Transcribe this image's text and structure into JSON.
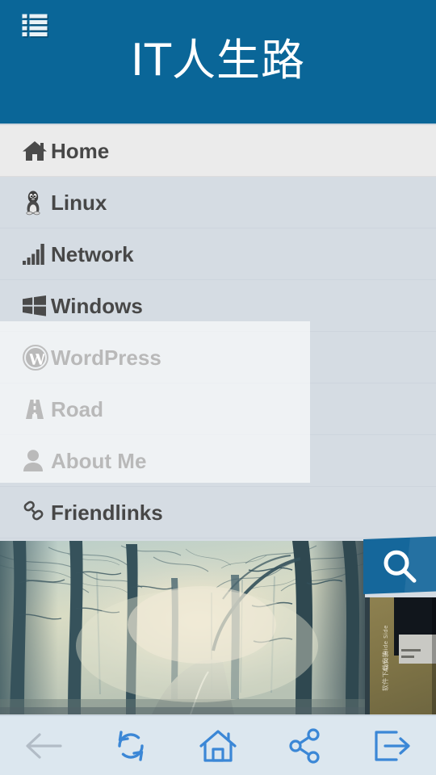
{
  "header": {
    "menu_icon": "list-icon",
    "title": "IT人生路",
    "background_color": "#0a6698",
    "title_color": "#ffffff"
  },
  "nav": {
    "active_index": 0,
    "active_background": "#ebebeb",
    "row_background": "#d5dce3",
    "label_color": "#474747",
    "items": [
      {
        "label": "Home",
        "icon": "home-icon",
        "active": true
      },
      {
        "label": "Linux",
        "icon": "linux-tux-icon",
        "active": false
      },
      {
        "label": "Network",
        "icon": "signal-bars-icon",
        "active": false
      },
      {
        "label": "Windows",
        "icon": "windows-icon",
        "active": false
      },
      {
        "label": "WordPress",
        "icon": "wordpress-icon",
        "active": false
      },
      {
        "label": "Road",
        "icon": "road-icon",
        "active": false
      },
      {
        "label": "About Me",
        "icon": "user-icon",
        "active": false
      },
      {
        "label": "Friendlinks",
        "icon": "chain-link-icon",
        "active": false
      }
    ]
  },
  "hero": {
    "name": "foggy-forest-road-photo",
    "description": "Misty winter forest with bare trees and a road receding into fog"
  },
  "search": {
    "icon": "search-icon",
    "background_color": "#15679b",
    "icon_color": "#ffffff"
  },
  "thumbnail": {
    "name": "article-thumbnail",
    "caption_vertical": "Auto-Hide Side",
    "caption_vertical_2": "软件下载安装"
  },
  "bottombar": {
    "background_color": "#dce7ef",
    "active_color": "#3b87d6",
    "disabled_color": "#b2bcc6",
    "buttons": [
      {
        "name": "back-button",
        "icon": "arrow-left-icon",
        "enabled": false
      },
      {
        "name": "refresh-button",
        "icon": "refresh-icon",
        "enabled": true
      },
      {
        "name": "home-button",
        "icon": "home-outline-icon",
        "enabled": true
      },
      {
        "name": "share-button",
        "icon": "share-nodes-icon",
        "enabled": true
      },
      {
        "name": "exit-button",
        "icon": "exit-icon",
        "enabled": true
      }
    ]
  }
}
